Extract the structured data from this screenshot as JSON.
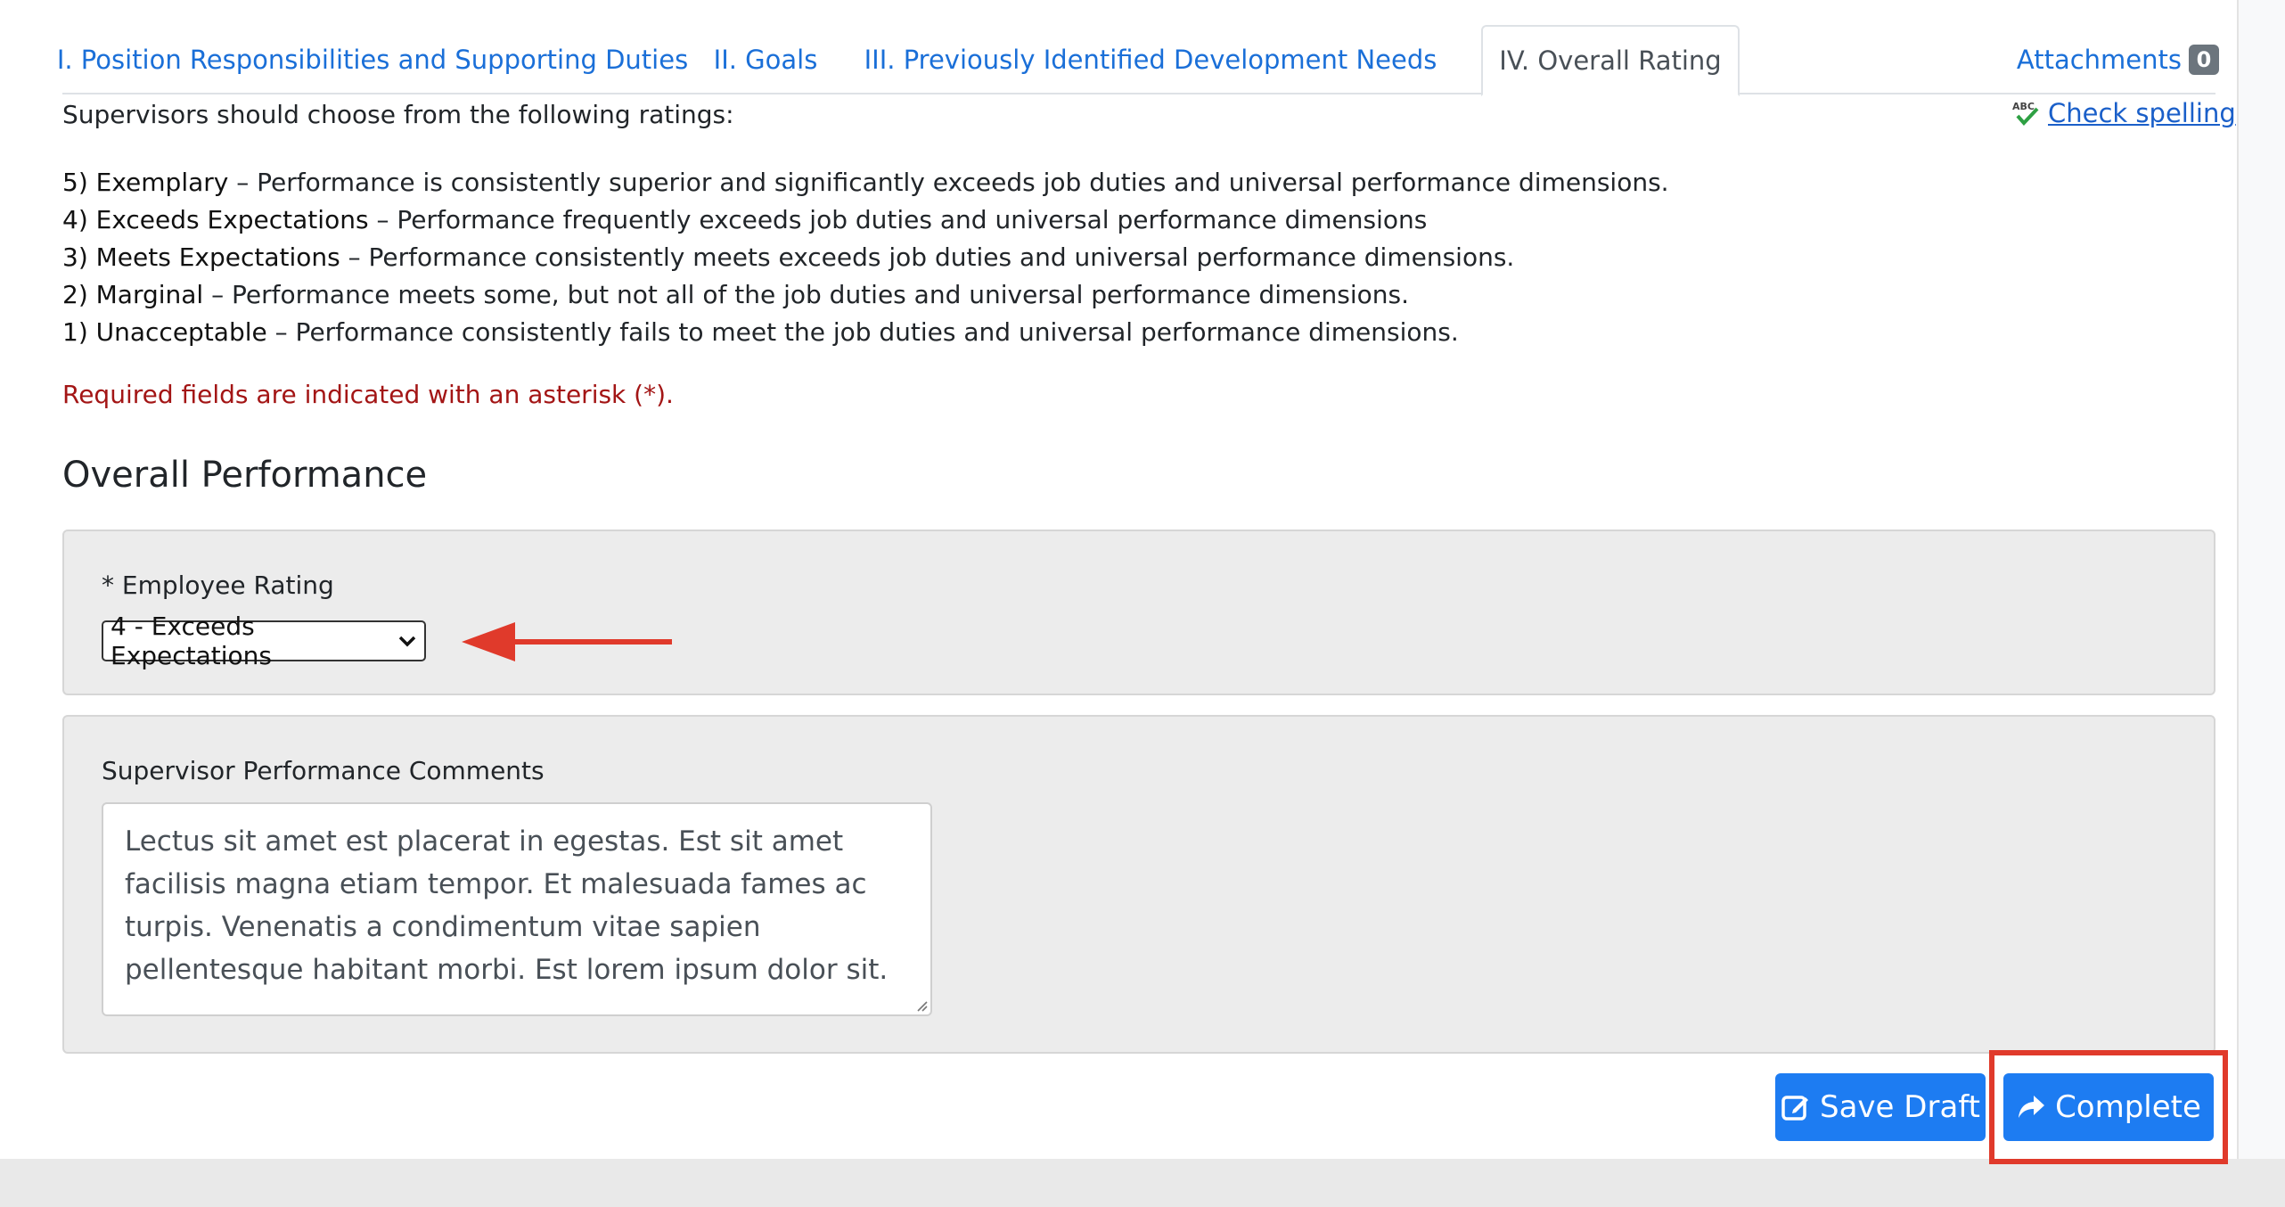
{
  "tabs": [
    {
      "label": "I. Position Responsibilities and Supporting Duties"
    },
    {
      "label": "II. Goals"
    },
    {
      "label": "III. Previously Identified Development Needs"
    },
    {
      "label": "IV. Overall Rating"
    }
  ],
  "attachments": {
    "label": "Attachments",
    "count": "0"
  },
  "spellcheck": {
    "label": "Check spelling"
  },
  "intro": "Supervisors should choose from the following ratings:",
  "ratings": [
    {
      "term": "5) Exemplary",
      "desc": " – Performance is consistently superior and significantly exceeds job duties and universal performance dimensions."
    },
    {
      "term": "4) Exceeds Expectations",
      "desc": " – Performance frequently exceeds job duties and universal performance dimensions"
    },
    {
      "term": "3) Meets Expectations",
      "desc": " – Performance consistently meets exceeds job duties and universal performance dimensions."
    },
    {
      "term": "2) Marginal",
      "desc": " – Performance meets some, but not all of the job duties and universal performance dimensions."
    },
    {
      "term": "1) Unacceptable",
      "desc": " – Performance consistently fails to meet the job duties and universal performance dimensions."
    }
  ],
  "required_note": "Required fields are indicated with an asterisk (*).",
  "section_title": "Overall Performance",
  "employee_rating": {
    "label": "* Employee Rating",
    "selected": "4 - Exceeds Expectations"
  },
  "comments": {
    "label": "Supervisor Performance Comments",
    "value": "Lectus sit amet est placerat in egestas. Est sit amet facilisis magna etiam tempor. Et malesuada fames ac turpis. Venenatis a condimentum vitae sapien pellentesque habitant morbi. Est lorem ipsum dolor sit."
  },
  "buttons": {
    "save": "Save Draft",
    "complete": "Complete"
  },
  "colors": {
    "accent": "#1d7cf2",
    "link": "#1a6fd8",
    "required": "#a31515",
    "annotation": "#e03a2b"
  },
  "icons": {
    "spell": "spellcheck-icon",
    "save": "edit-square-icon",
    "complete": "share-arrow-icon",
    "select": "chevron-down-icon"
  }
}
